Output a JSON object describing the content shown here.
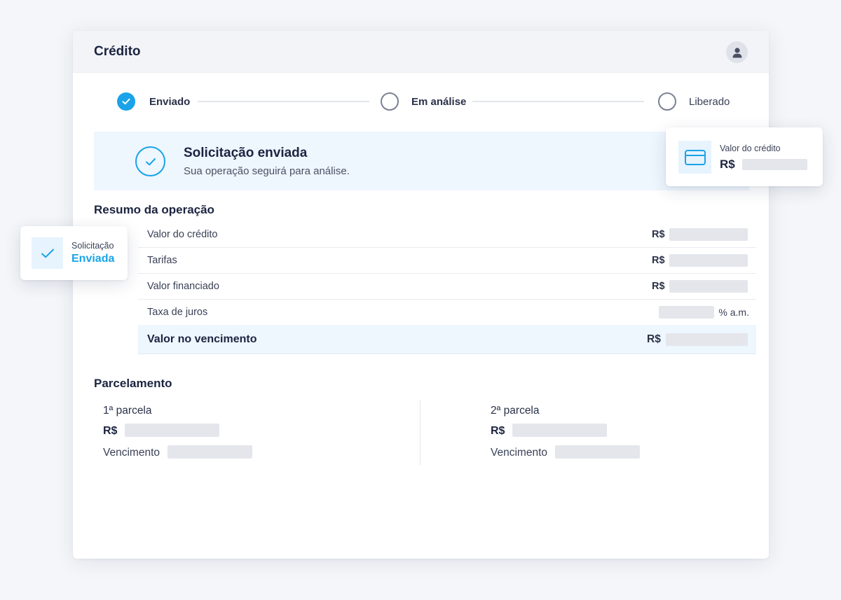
{
  "app": {
    "title": "Crédito"
  },
  "stepper": {
    "steps": [
      {
        "label": "Enviado",
        "state": "done"
      },
      {
        "label": "Em análise",
        "state": "pending"
      },
      {
        "label": "Liberado",
        "state": "pending"
      }
    ]
  },
  "banner": {
    "title": "Solicitação enviada",
    "subtitle": "Sua operação seguirá para análise."
  },
  "summary": {
    "title": "Resumo da operação",
    "rows": [
      {
        "label": "Valor do crédito",
        "currency": "R$"
      },
      {
        "label": "Tarifas",
        "currency": "R$"
      },
      {
        "label": "Valor financiado",
        "currency": "R$"
      },
      {
        "label": "Taxa de juros",
        "unit": "% a.m."
      }
    ],
    "total": {
      "label": "Valor no vencimento",
      "currency": "R$"
    }
  },
  "installments": {
    "title": "Parcelamento",
    "items": [
      {
        "title": "1ª parcela",
        "currency": "R$",
        "due_label": "Vencimento"
      },
      {
        "title": "2ª parcela",
        "currency": "R$",
        "due_label": "Vencimento"
      }
    ]
  },
  "float_credit": {
    "label": "Valor do crédito",
    "currency": "R$"
  },
  "float_status": {
    "label": "Solicitação",
    "value": "Enviada"
  },
  "colors": {
    "accent": "#1aa3e8",
    "banner_bg": "#eef6fe",
    "placeholder": "#e4e6ec"
  }
}
